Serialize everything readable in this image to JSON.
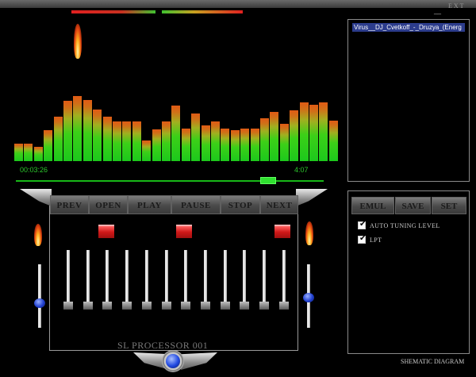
{
  "window": {
    "minimize_label": "__",
    "exit_label": "EXT"
  },
  "player": {
    "time_elapsed": "00:03:26",
    "time_total": "4:07",
    "spectrum_levels": [
      0.22,
      0.22,
      0.18,
      0.4,
      0.57,
      0.78,
      0.84,
      0.79,
      0.66,
      0.57,
      0.51,
      0.51,
      0.51,
      0.27,
      0.41,
      0.51,
      0.71,
      0.42,
      0.61,
      0.46,
      0.51,
      0.42,
      0.4,
      0.42,
      0.42,
      0.55,
      0.63,
      0.48,
      0.65,
      0.76,
      0.72,
      0.76,
      0.52
    ]
  },
  "playlist": {
    "items": [
      "Virus__DJ_Cvetkoff_-_Druzya_(Energ"
    ]
  },
  "transport": {
    "prev": "PREV",
    "open": "OPEN",
    "play": "PLAY",
    "pause": "PAUSE",
    "stop": "STOP",
    "next": "NEXT"
  },
  "processor": {
    "label": "SL PROCESSOR 001",
    "eq_band_count": 12
  },
  "settings": {
    "emul": "EMUL",
    "save": "SAVE",
    "set": "SET",
    "auto_tuning": "AUTO TUNING LEVEL",
    "auto_tuning_checked": true,
    "lpt": "LPT",
    "lpt_checked": true,
    "schematic_link": "SHEMATIC DIAGRAM"
  },
  "colors": {
    "spectrum_low": "#1cc81c",
    "spectrum_high": "#e05a14",
    "time_text": "#2cc82c",
    "playlist_selection": "#2c3c8c",
    "preset_active": "#d01818",
    "knob_blue": "#2040d0"
  }
}
